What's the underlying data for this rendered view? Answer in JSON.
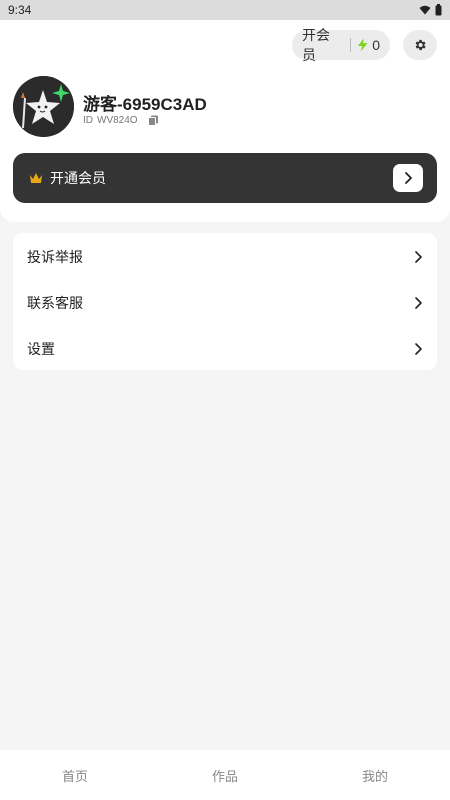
{
  "status_bar": {
    "time": "9:34"
  },
  "header": {
    "vip_pill_label": "开会员",
    "energy_count": "0"
  },
  "profile": {
    "username": "游客-6959C3AD",
    "id_label": "ID",
    "id_value": "WV824O"
  },
  "vip_banner": {
    "label": "开通会员"
  },
  "menu": {
    "items": [
      {
        "label": "投诉举报"
      },
      {
        "label": "联系客服"
      },
      {
        "label": "设置"
      }
    ]
  },
  "bottom_nav": {
    "items": [
      {
        "label": "首页"
      },
      {
        "label": "作品"
      },
      {
        "label": "我的"
      }
    ]
  },
  "colors": {
    "banner_bg": "#343434",
    "crown": "#e6a817",
    "bolt": "#7ed321"
  }
}
